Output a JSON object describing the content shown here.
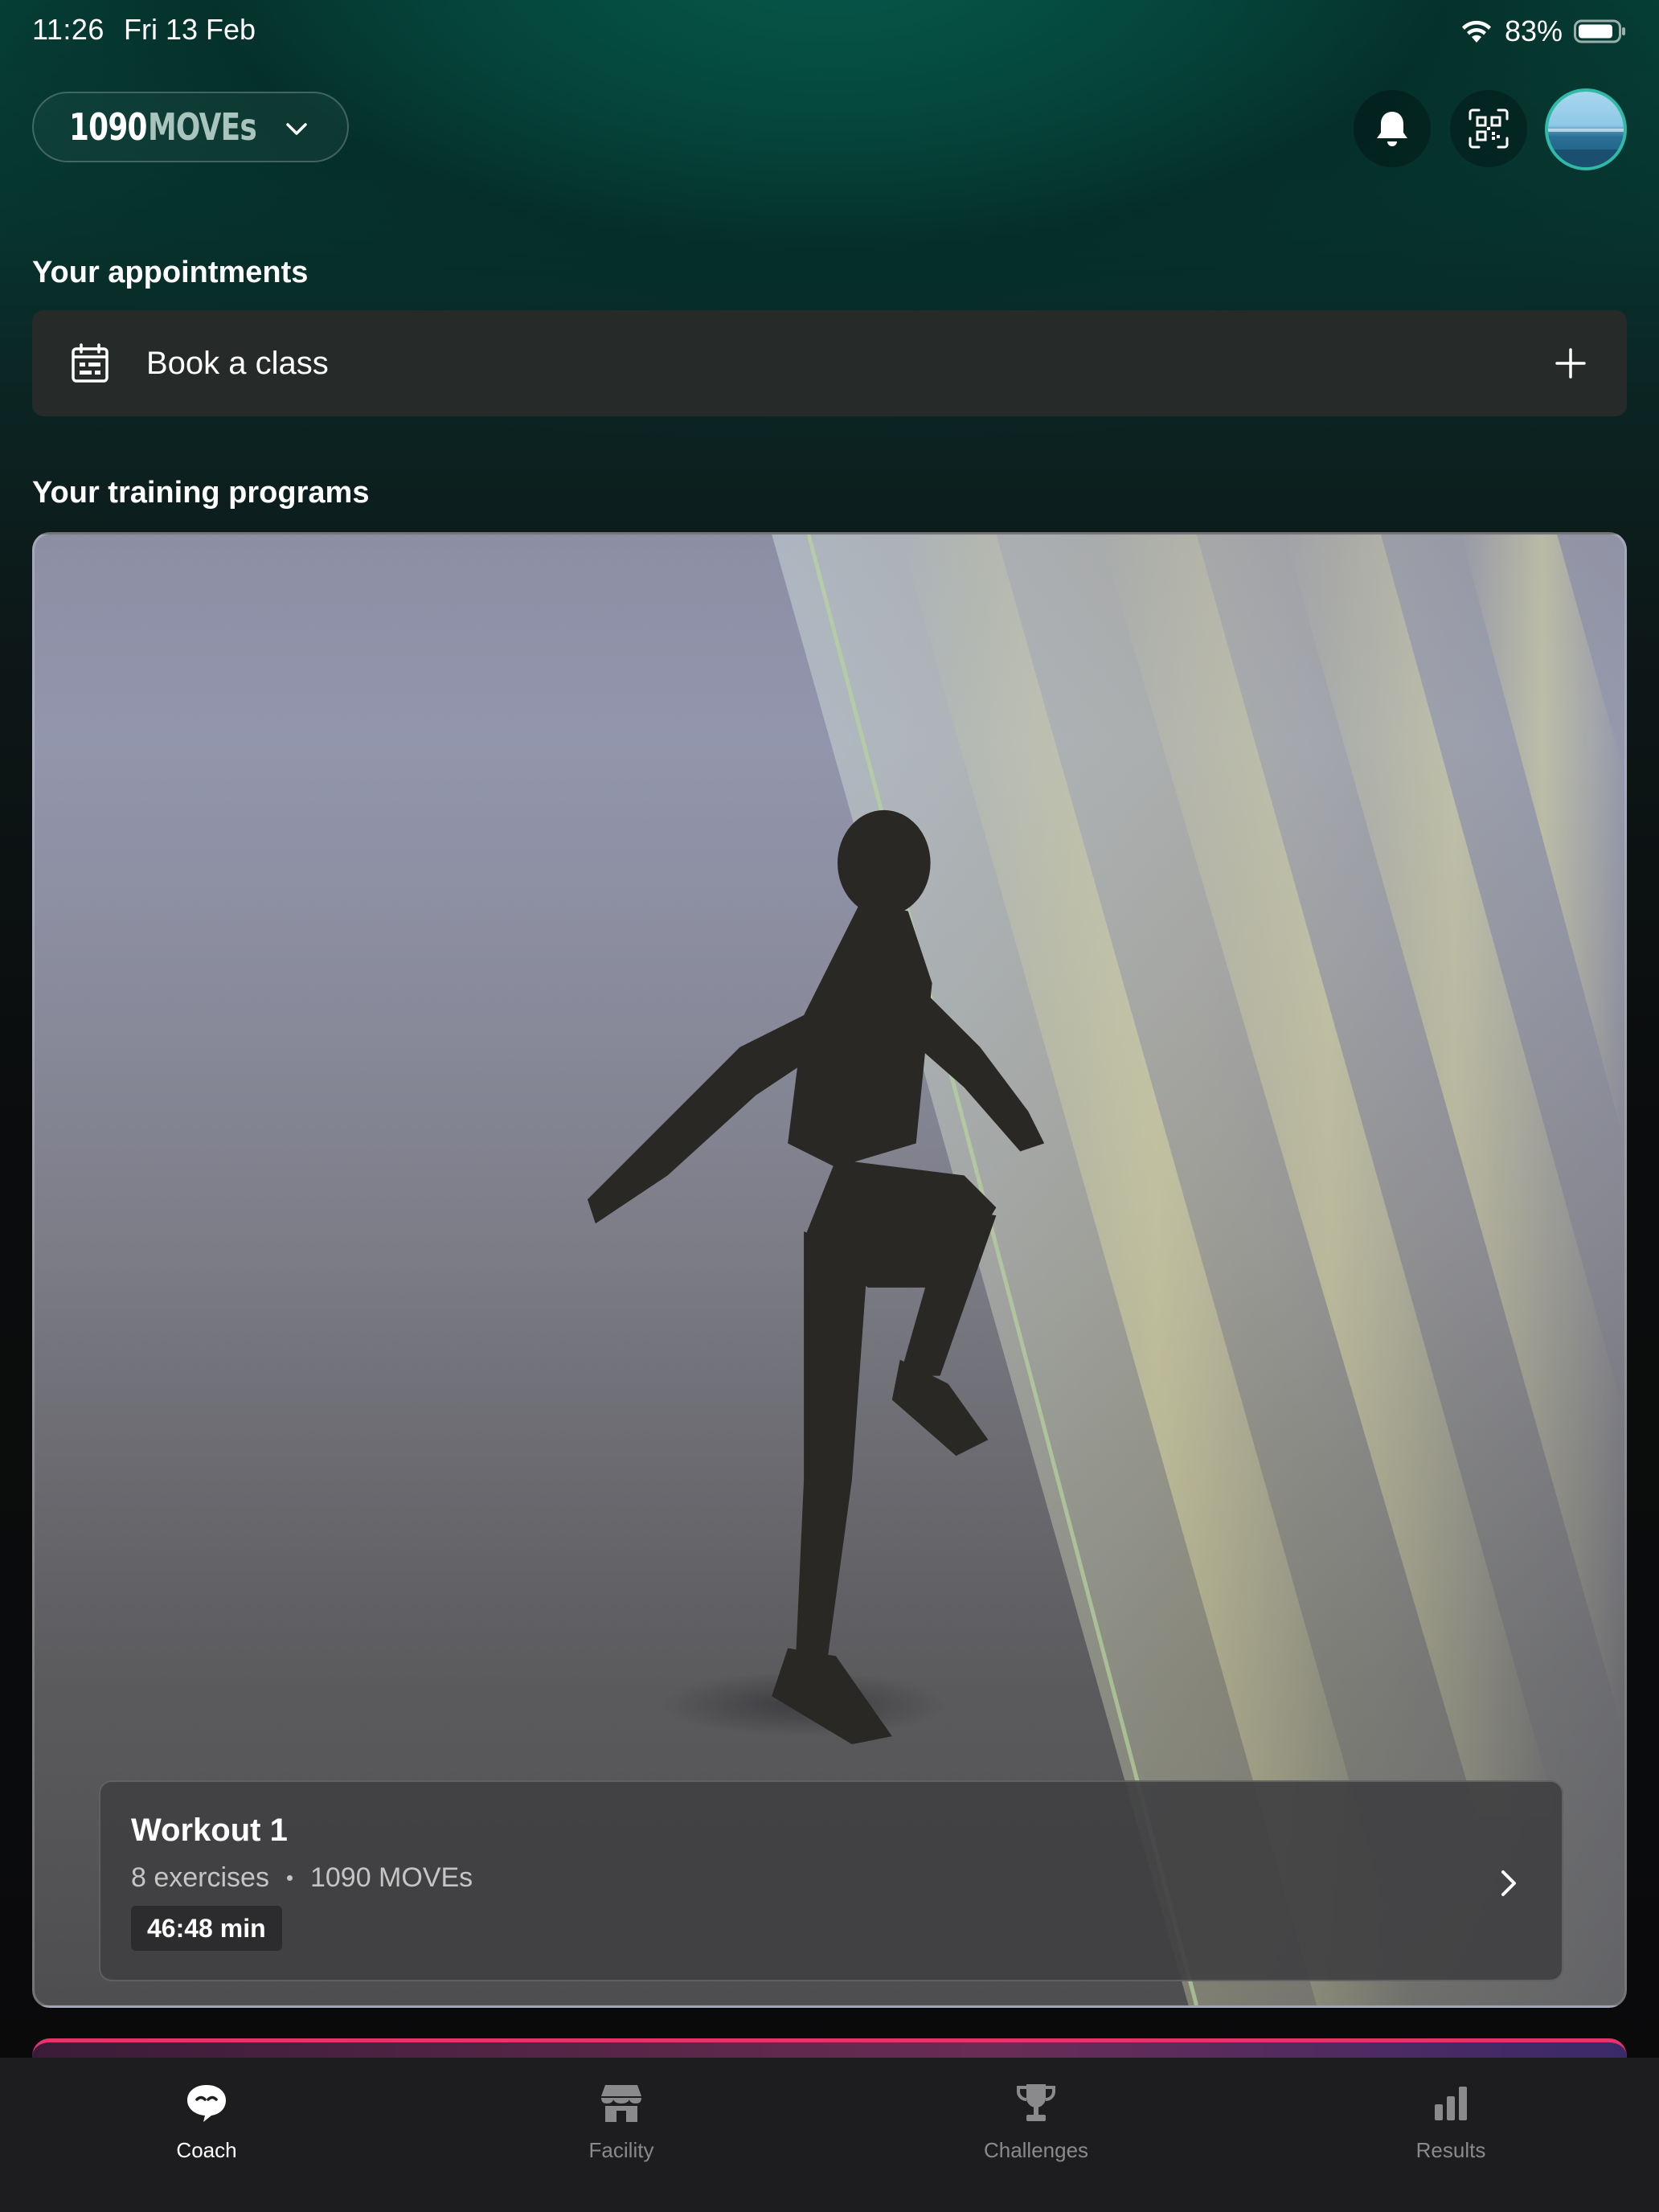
{
  "status_bar": {
    "time": "11:26",
    "date": "Fri 13 Feb",
    "battery_percent": "83%",
    "icons": [
      "wifi-icon",
      "battery-icon"
    ]
  },
  "header": {
    "brand_number": "1090",
    "brand_name": "MOVEs",
    "icons": [
      "chevron-down-icon",
      "bell-icon",
      "qr-code-icon",
      "avatar"
    ]
  },
  "appointments": {
    "title": "Your appointments",
    "book_label": "Book a class",
    "icons": [
      "calendar-icon",
      "plus-icon"
    ]
  },
  "programs": {
    "title": "Your training programs",
    "items": [
      {
        "title": "Workout 1",
        "exercises": "8 exercises",
        "brand": "1090 MOVEs",
        "duration": "46:48 min"
      }
    ]
  },
  "tab_bar": {
    "active": "Coach",
    "tabs": [
      {
        "label": "Coach",
        "icon": "coach-chat-icon"
      },
      {
        "label": "Facility",
        "icon": "storefront-icon"
      },
      {
        "label": "Challenges",
        "icon": "trophy-icon"
      },
      {
        "label": "Results",
        "icon": "bar-chart-icon"
      }
    ]
  },
  "colors": {
    "background_top": "#054a3e",
    "background_bottom": "#0a0a0b",
    "accent_teal": "#2fb9a6",
    "next_card_border": "#e7326a",
    "card_background": "#262a29"
  }
}
